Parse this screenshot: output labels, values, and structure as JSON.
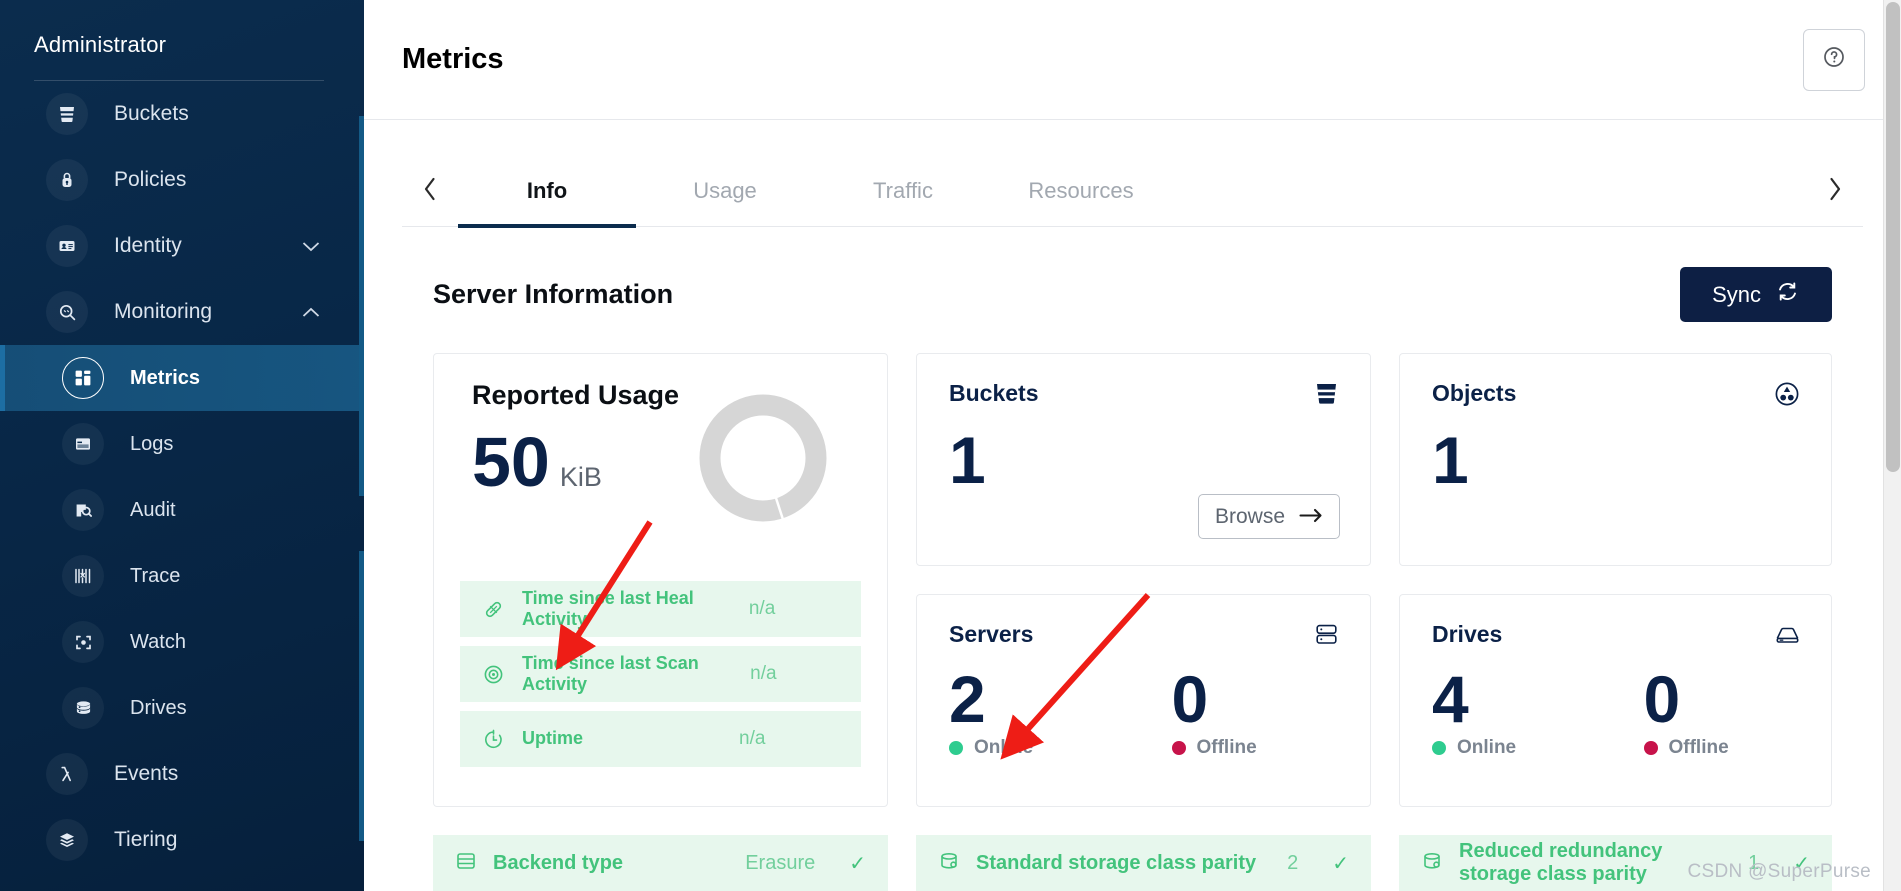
{
  "sidebar": {
    "title": "Administrator",
    "items": [
      {
        "label": "Buckets",
        "icon": "bucket-icon",
        "level": "top",
        "active": false,
        "expandable": false
      },
      {
        "label": "Policies",
        "icon": "lock-icon",
        "level": "top",
        "active": false,
        "expandable": false
      },
      {
        "label": "Identity",
        "icon": "id-card-icon",
        "level": "top",
        "active": false,
        "expandable": true,
        "chevron": "chevron-down"
      },
      {
        "label": "Monitoring",
        "icon": "magnifier-icon",
        "level": "top",
        "active": false,
        "expandable": true,
        "chevron": "chevron-up"
      },
      {
        "label": "Metrics",
        "icon": "dashboard-icon",
        "level": "sub",
        "active": true,
        "expandable": false
      },
      {
        "label": "Logs",
        "icon": "logs-icon",
        "level": "sub",
        "active": false,
        "expandable": false
      },
      {
        "label": "Audit",
        "icon": "audit-icon",
        "level": "sub",
        "active": false,
        "expandable": false
      },
      {
        "label": "Trace",
        "icon": "trace-icon",
        "level": "sub",
        "active": false,
        "expandable": false
      },
      {
        "label": "Watch",
        "icon": "watch-icon",
        "level": "sub",
        "active": false,
        "expandable": false
      },
      {
        "label": "Drives",
        "icon": "drives-icon",
        "level": "sub",
        "active": false,
        "expandable": false
      },
      {
        "label": "Events",
        "icon": "lambda-icon",
        "level": "top",
        "active": false,
        "expandable": false
      },
      {
        "label": "Tiering",
        "icon": "layers-icon",
        "level": "top",
        "active": false,
        "expandable": false
      }
    ]
  },
  "header": {
    "title": "Metrics",
    "help_icon": "help-circle-icon"
  },
  "tabs": {
    "prev_icon": "chevron-left-icon",
    "next_icon": "chevron-right-icon",
    "items": [
      {
        "label": "Info",
        "active": true
      },
      {
        "label": "Usage",
        "active": false
      },
      {
        "label": "Traffic",
        "active": false
      },
      {
        "label": "Resources",
        "active": false
      }
    ]
  },
  "section": {
    "title": "Server Information",
    "sync_label": "Sync",
    "sync_icon": "refresh-icon"
  },
  "cards": {
    "buckets": {
      "title": "Buckets",
      "value": "1",
      "icon": "bucket-icon",
      "browse_label": "Browse",
      "browse_icon": "arrow-right-icon"
    },
    "objects": {
      "title": "Objects",
      "value": "1",
      "icon": "objects-icon"
    },
    "servers": {
      "title": "Servers",
      "icon": "server-icon",
      "online_value": "2",
      "online_label": "Online",
      "offline_value": "0",
      "offline_label": "Offline"
    },
    "drives": {
      "title": "Drives",
      "icon": "drive-icon",
      "online_value": "4",
      "online_label": "Online",
      "offline_value": "0",
      "offline_label": "Offline"
    }
  },
  "reported_usage": {
    "title": "Reported Usage",
    "value": "50",
    "unit": "KiB",
    "donut_icon": "donut-chart",
    "rows": [
      {
        "icon": "heal-icon",
        "label": "Time since last Heal Activity",
        "value": "n/a"
      },
      {
        "icon": "scan-icon",
        "label": "Time since last Scan Activity",
        "value": "n/a"
      },
      {
        "icon": "uptime-icon",
        "label": "Uptime",
        "value": "n/a"
      }
    ]
  },
  "bottom_strip": [
    {
      "icon": "backend-icon",
      "label": "Backend type",
      "value": "Erasure",
      "check": "✓"
    },
    {
      "icon": "parity-icon",
      "label": "Standard storage class parity",
      "value": "2",
      "check": "✓"
    },
    {
      "icon": "parity-icon",
      "label": "Reduced redundancy storage class parity",
      "value": "1",
      "check": "✓"
    }
  ],
  "watermark": "CSDN @SuperPurse",
  "colors": {
    "sidebar_bg": "#082747",
    "sidebar_active": "#165079",
    "accent_navy": "#0b2147",
    "online_green": "#2ecc8f",
    "offline_red": "#c7134a",
    "row_green_bg": "#e7f7ed",
    "row_green_text": "#43c37c",
    "annotation_red": "#ee1d16"
  }
}
